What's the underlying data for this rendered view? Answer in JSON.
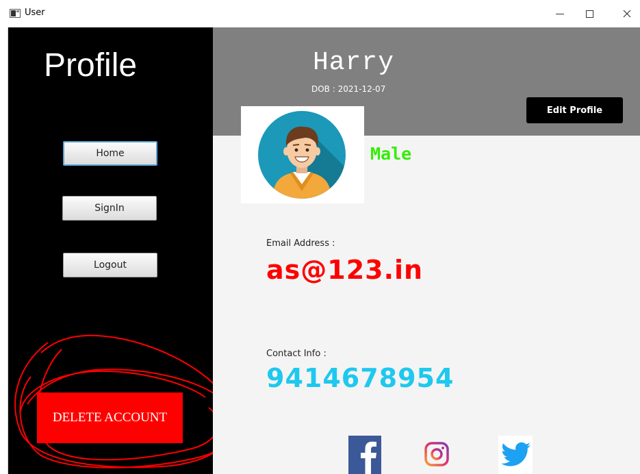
{
  "window": {
    "title": "User"
  },
  "sidebar": {
    "title": "Profile",
    "buttons": {
      "home": "Home",
      "signin": "SignIn",
      "logout": "Logout"
    },
    "delete_account": "DELETE ACCOUNT"
  },
  "header": {
    "name": "Harry",
    "dob": "DOB :  2021-12-07",
    "edit_profile": "Edit Profile"
  },
  "profile": {
    "gender": "Male",
    "email_label": "Email Address :",
    "email": "as@123.in",
    "contact_label": "Contact Info :",
    "contact": "9414678954"
  },
  "icons": {
    "avatar": "avatar-icon",
    "facebook": "facebook-icon",
    "instagram": "instagram-icon",
    "twitter": "twitter-icon"
  },
  "colors": {
    "sidebar_bg": "#000000",
    "header_bg": "#808080",
    "body_bg": "#f4f4f4",
    "delete_red": "#ff0000",
    "gender_green": "#33ee00",
    "email_red": "#ff0000",
    "contact_cyan": "#1ec8ee"
  }
}
